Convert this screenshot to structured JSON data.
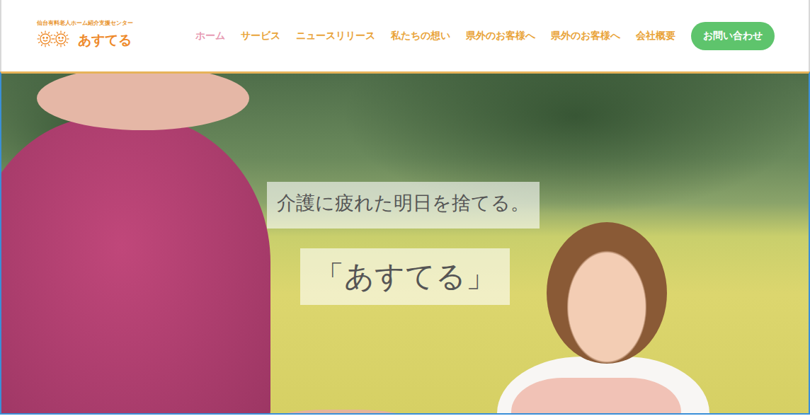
{
  "header": {
    "logo_subtitle": "仙台有料老人ホーム紹介支援センター",
    "logo_name": "あすてる"
  },
  "nav": [
    {
      "label": "ホーム",
      "selected": true
    },
    {
      "label": "サービス",
      "selected": false
    },
    {
      "label": "ニュースリリース",
      "selected": false
    },
    {
      "label": "私たちの想い",
      "selected": false
    },
    {
      "label": "県外のお客様へ",
      "selected": false
    },
    {
      "label": "県外のお客様へ",
      "selected": false
    },
    {
      "label": "会社概要",
      "selected": false
    }
  ],
  "contact_button": "お問い合わせ",
  "hero": {
    "tagline": "介護に疲れた明日を捨てる。",
    "title": "「あすてる」"
  }
}
